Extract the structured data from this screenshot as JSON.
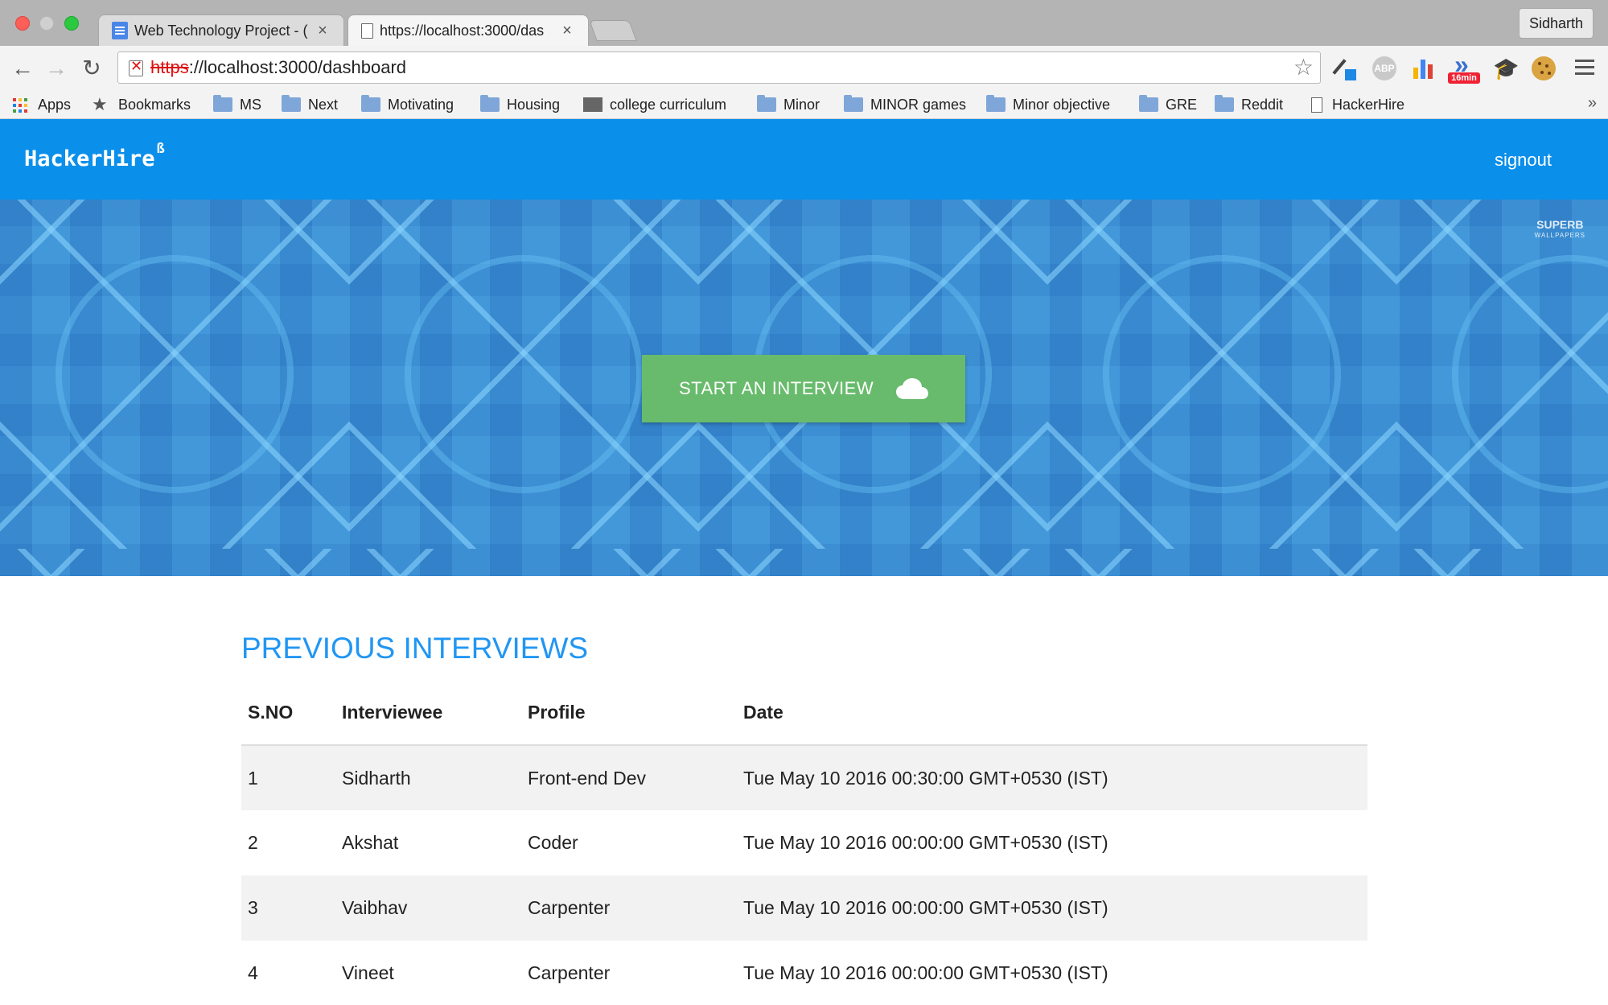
{
  "browser": {
    "tabs": [
      {
        "title": "Web Technology Project - (",
        "icon": "google-docs-icon"
      },
      {
        "title": "https://localhost:3000/das",
        "icon": "page-icon"
      }
    ],
    "profile_name": "Sidharth",
    "url_scheme": "https",
    "url_rest": "://localhost:3000/dashboard",
    "extensions": [
      "eyedropper-icon",
      "adblock-icon",
      "chart-icon",
      "16min-icon",
      "graduation-cap-icon",
      "cookie-icon"
    ],
    "extension_badge": "16min",
    "bookmarks": [
      {
        "label": "Apps",
        "icon": "apps-icon"
      },
      {
        "label": "Bookmarks",
        "icon": "star-icon"
      },
      {
        "label": "MS",
        "icon": "folder-icon"
      },
      {
        "label": "Next",
        "icon": "folder-icon"
      },
      {
        "label": "Motivating",
        "icon": "folder-icon"
      },
      {
        "label": "Housing",
        "icon": "folder-icon"
      },
      {
        "label": "college curriculum",
        "icon": "image-folder-icon"
      },
      {
        "label": "Minor",
        "icon": "folder-icon"
      },
      {
        "label": "MINOR games",
        "icon": "folder-icon"
      },
      {
        "label": "Minor objective",
        "icon": "folder-icon"
      },
      {
        "label": "GRE",
        "icon": "folder-icon"
      },
      {
        "label": "Reddit",
        "icon": "folder-icon"
      },
      {
        "label": "HackerHire",
        "icon": "page-icon"
      }
    ],
    "more_bookmarks": "»"
  },
  "app": {
    "brand": "HackerHire",
    "brand_sup": "ß",
    "signout_label": "signout",
    "accent_color": "#0a8fea"
  },
  "hero": {
    "watermark_top": "SUPERB",
    "watermark_bottom": "WALLPAPERS",
    "cta_label": "START AN INTERVIEW",
    "cta_color": "#68bb6c"
  },
  "interviews": {
    "title": "PREVIOUS INTERVIEWS",
    "columns": [
      "S.NO",
      "Interviewee",
      "Profile",
      "Date"
    ],
    "rows": [
      [
        "1",
        "Sidharth",
        "Front-end Dev",
        "Tue May 10 2016 00:30:00 GMT+0530 (IST)"
      ],
      [
        "2",
        "Akshat",
        "Coder",
        "Tue May 10 2016 00:00:00 GMT+0530 (IST)"
      ],
      [
        "3",
        "Vaibhav",
        "Carpenter",
        "Tue May 10 2016 00:00:00 GMT+0530 (IST)"
      ],
      [
        "4",
        "Vineet",
        "Carpenter",
        "Tue May 10 2016 00:00:00 GMT+0530 (IST)"
      ]
    ]
  }
}
